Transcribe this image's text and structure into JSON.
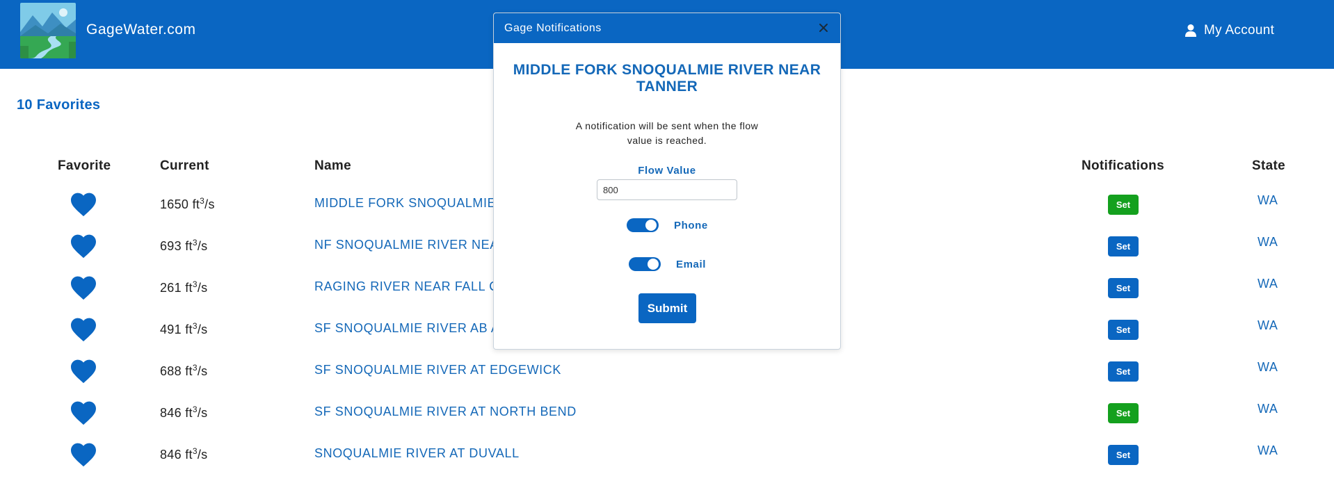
{
  "header": {
    "site_title": "GageWater.com",
    "account_label": "My Account",
    "brand_color": "#0a66c2"
  },
  "favorites": {
    "count_label": "10 Favorites"
  },
  "table": {
    "headers": {
      "favorite": "Favorite",
      "current": "Current",
      "name": "Name",
      "notifications": "Notifications",
      "state": "State"
    },
    "unit": "ft",
    "unit_exp": "3",
    "unit_suffix": "/s",
    "rows": [
      {
        "current": "1650",
        "name": "MIDDLE FORK SNOQUALMIE",
        "set_label": "Set",
        "set_color": "green",
        "state": "WA"
      },
      {
        "current": "693",
        "name": "NF SNOQUALMIE RIVER NEA",
        "set_label": "Set",
        "set_color": "blue",
        "state": "WA"
      },
      {
        "current": "261",
        "name": "RAGING RIVER NEAR FALL C",
        "set_label": "Set",
        "set_color": "blue",
        "state": "WA"
      },
      {
        "current": "491",
        "name": "SF SNOQUALMIE RIVER AB A",
        "set_label": "Set",
        "set_color": "blue",
        "state": "WA"
      },
      {
        "current": "688",
        "name": "SF SNOQUALMIE RIVER AT EDGEWICK",
        "set_label": "Set",
        "set_color": "blue",
        "state": "WA"
      },
      {
        "current": "846",
        "name": "SF SNOQUALMIE RIVER AT NORTH BEND",
        "set_label": "Set",
        "set_color": "green",
        "state": "WA"
      },
      {
        "current": "846",
        "name": "SNOQUALMIE RIVER AT DUVALL",
        "set_label": "Set",
        "set_color": "blue",
        "state": "WA"
      }
    ]
  },
  "modal": {
    "title": "Gage Notifications",
    "gage_name": "MIDDLE FORK SNOQUALMIE RIVER NEAR TANNER",
    "notice": "A notification will be sent when the flow value is reached.",
    "flow_label": "Flow Value",
    "flow_value": "800",
    "phone_label": "Phone",
    "email_label": "Email",
    "phone_on": true,
    "email_on": true,
    "submit_label": "Submit"
  }
}
